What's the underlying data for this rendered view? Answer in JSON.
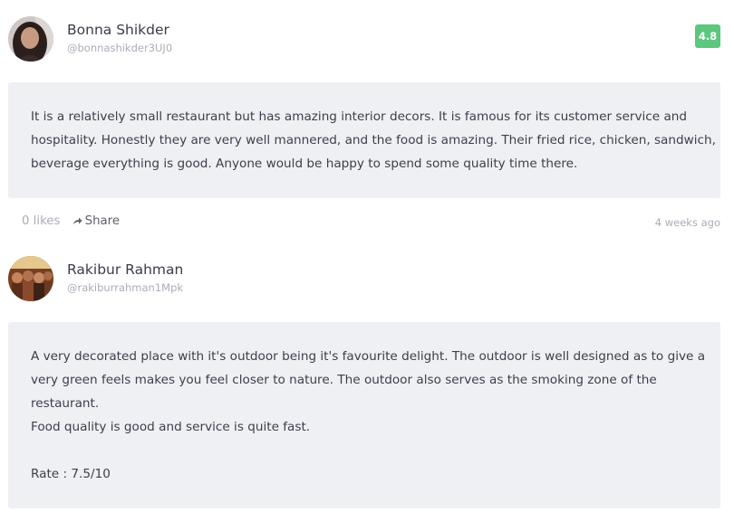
{
  "colors": {
    "rating_badge": "#5cc77d",
    "body_background": "#eff0f3",
    "muted_text": "#a9adb6"
  },
  "reviews": [
    {
      "author": "Bonna Shikder",
      "handle": "@bonnashikder3UJ0",
      "rating": "4.8",
      "body": [
        "It is a relatively small restaurant but has amazing interior decors. It is famous for its customer service and",
        "hospitality. Honestly they are very well mannered, and the food is amazing. Their fried rice, chicken, sandwich,",
        "beverage everything is good. Anyone would be happy to spend some quality time there."
      ],
      "likes": "0 likes",
      "share_label": "Share",
      "share_icon": "share-arrow-icon",
      "timestamp": "4 weeks ago",
      "avatar_icon": "avatar-photo"
    },
    {
      "author": "Rakibur Rahman",
      "handle": "@rakiburrahman1Mpk",
      "body": [
        "A very decorated place with it's outdoor being it's favourite delight. The outdoor is well designed as to give a",
        "very green feels makes you feel closer to nature. The outdoor also serves as the smoking zone of the",
        "restaurant.",
        "Food quality is good and service is quite fast.",
        "",
        "Rate : 7.5/10"
      ],
      "avatar_icon": "avatar-photo"
    }
  ]
}
